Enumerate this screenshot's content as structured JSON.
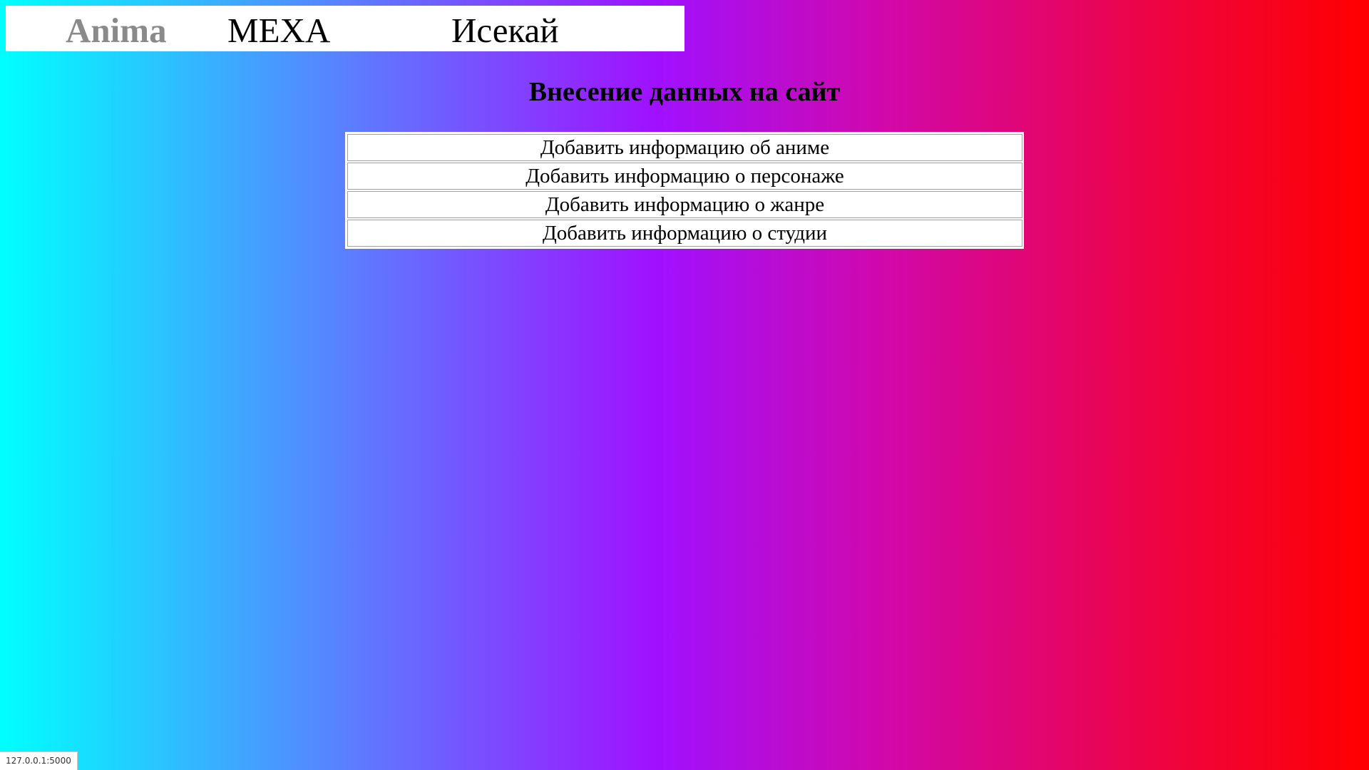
{
  "nav": {
    "logo": "Anima",
    "items": [
      {
        "label": "МЕХА"
      },
      {
        "label": "Исекай"
      }
    ]
  },
  "main": {
    "title": "Внесение данных на сайт",
    "actions": [
      {
        "label": "Добавить информацию об аниме"
      },
      {
        "label": "Добавить информацию о персонаже"
      },
      {
        "label": "Добавить информацию о жанре"
      },
      {
        "label": "Добавить информацию о студии"
      }
    ]
  },
  "status_bar": {
    "url": "127.0.0.1:5000"
  },
  "colors": {
    "gradient_left": "#00ffff",
    "gradient_middle": "#a010ff",
    "gradient_right": "#ff0000",
    "logo": "#8a8a8a"
  }
}
